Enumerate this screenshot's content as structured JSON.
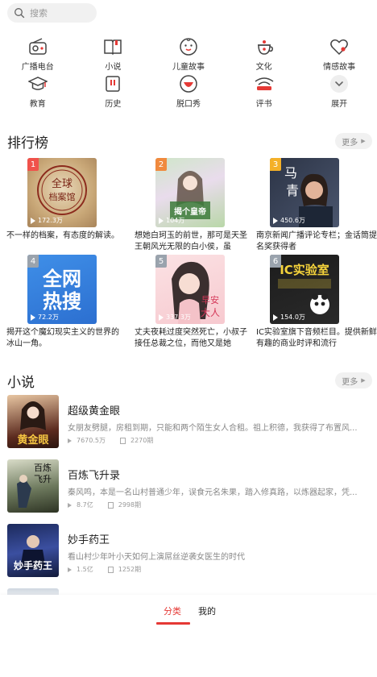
{
  "search": {
    "placeholder": "搜索"
  },
  "categories": [
    {
      "label": "广播电台",
      "icon": "radio-icon"
    },
    {
      "label": "小说",
      "icon": "book-icon"
    },
    {
      "label": "儿童故事",
      "icon": "kid-face-icon"
    },
    {
      "label": "文化",
      "icon": "teapot-icon"
    },
    {
      "label": "情感故事",
      "icon": "heart-icon"
    },
    {
      "label": "教育",
      "icon": "graduation-cap-icon"
    },
    {
      "label": "历史",
      "icon": "history-book-icon"
    },
    {
      "label": "脱口秀",
      "icon": "talk-show-icon"
    },
    {
      "label": "评书",
      "icon": "storytelling-icon"
    },
    {
      "label": "展开",
      "icon": "chevron-down-icon"
    }
  ],
  "ranking": {
    "title": "排行榜",
    "more": "更多",
    "items": [
      {
        "rank": "1",
        "plays": "172.3万",
        "desc": "不一样的档案，有态度的解读。",
        "cover_text": "全球档案馆",
        "badge_color": "#f0524b"
      },
      {
        "rank": "2",
        "plays": "104万",
        "desc": "想她白珂玉的前世，那可是天圣王朝风光无限的白小侯，虽",
        "cover_text": "揭个皇帝来种田",
        "badge_color": "#f08a3e"
      },
      {
        "rank": "3",
        "plays": "450.6万",
        "desc": "南京新闻广播评论专栏；金话筒提名奖获得者",
        "cover_text": "马青时间",
        "badge_color": "#f4b028"
      },
      {
        "rank": "4",
        "plays": "72.2万",
        "desc": "揭开这个魔幻现实主义的世界的冰山一角。",
        "cover_text": "全网热搜",
        "badge_color": "#9aa3ad"
      },
      {
        "rank": "5",
        "plays": "337.3万",
        "desc": "丈夫夜耗过度突然死亡，小叔子接任总裁之位，而他又是她",
        "cover_text": "早安大人",
        "badge_color": "#9aa3ad"
      },
      {
        "rank": "6",
        "plays": "154.0万",
        "desc": "IC实验室旗下音频栏目。提供新鲜有趣的商业时评和流行",
        "cover_text": "IC实验室",
        "badge_color": "#9aa3ad"
      }
    ]
  },
  "novels": {
    "title": "小说",
    "more": "更多",
    "items": [
      {
        "title": "超级黄金眼",
        "desc": "女朋友劈腿，房租到期，只能和两个陌生女人合租。祖上积德，我获得了布置风...",
        "plays": "7670.5万",
        "episodes": "2270期",
        "cover_text": "黄金眼"
      },
      {
        "title": "百炼飞升录",
        "desc": "秦风鸣，本是一名山村普通少年，误食元名朱果，踏入修真路，以炼器起家，凭...",
        "plays": "8.7亿",
        "episodes": "2998期",
        "cover_text": "百炼飞升录"
      },
      {
        "title": "妙手药王",
        "desc": "看山村少年叶小天如何上演屌丝逆袭女医生的时代",
        "plays": "1.5亿",
        "episodes": "1252期",
        "cover_text": "妙手药王"
      }
    ]
  },
  "bottom_nav": {
    "tab_category": "分类",
    "tab_mine": "我的"
  },
  "colors": {
    "accent": "#e53935"
  }
}
